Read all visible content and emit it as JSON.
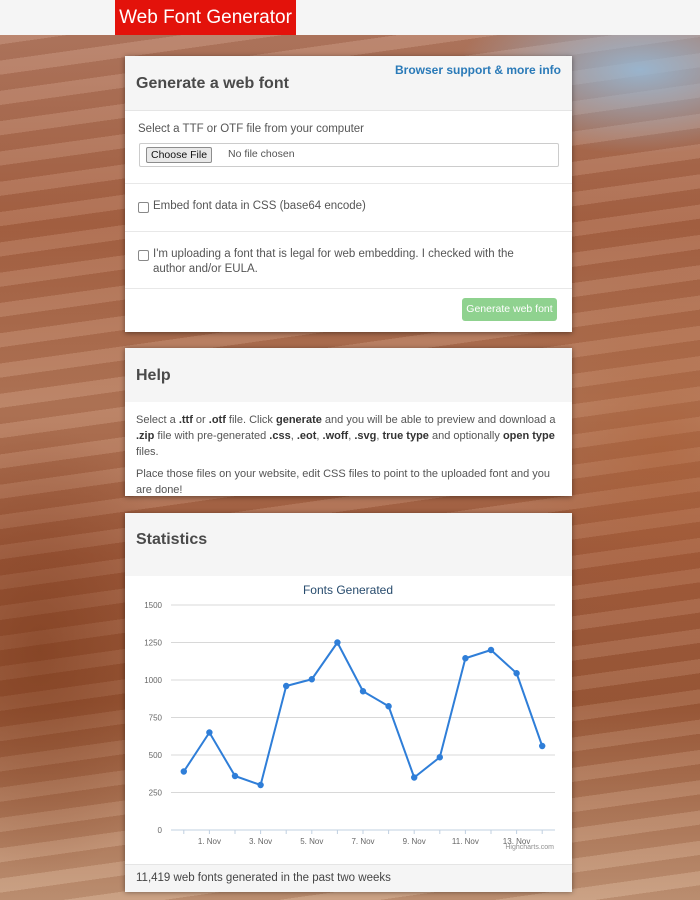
{
  "header": {
    "brand": "Web Font Generator"
  },
  "generate_panel": {
    "title": "Generate a web font",
    "support_link": "Browser support & more info",
    "file_label": "Select a TTF or OTF file from your computer",
    "choose_file_label": "Choose File",
    "file_status": "No file chosen",
    "embed_label": "Embed font data in CSS (base64 encode)",
    "legal_label": "I'm uploading a font that is legal for web embedding. I checked with the author and/or EULA.",
    "generate_button": "Generate web font"
  },
  "help_panel": {
    "title": "Help",
    "p1": [
      {
        "t": "Select a ",
        "b": false
      },
      {
        "t": ".ttf",
        "b": true
      },
      {
        "t": " or ",
        "b": false
      },
      {
        "t": ".otf",
        "b": true
      },
      {
        "t": " file. Click ",
        "b": false
      },
      {
        "t": "generate",
        "b": true
      },
      {
        "t": " and you will be able to preview and download a ",
        "b": false
      },
      {
        "t": ".zip",
        "b": true
      },
      {
        "t": " file with pre-generated ",
        "b": false
      },
      {
        "t": ".css",
        "b": true
      },
      {
        "t": ", ",
        "b": false
      },
      {
        "t": ".eot",
        "b": true
      },
      {
        "t": ", ",
        "b": false
      },
      {
        "t": ".woff",
        "b": true
      },
      {
        "t": ", ",
        "b": false
      },
      {
        "t": ".svg",
        "b": true
      },
      {
        "t": ", ",
        "b": false
      },
      {
        "t": "true type",
        "b": true
      },
      {
        "t": " and optionally ",
        "b": false
      },
      {
        "t": "open type",
        "b": true
      },
      {
        "t": " files.",
        "b": false
      }
    ],
    "p2": "Place those files on your website, edit CSS files to point to the uploaded font and you are done!"
  },
  "stats_panel": {
    "title": "Statistics",
    "footer": "11,419 web fonts generated in the past two weeks"
  },
  "chart_data": {
    "type": "line",
    "title": "Fonts Generated",
    "credit": "Highcharts.com",
    "color": "#2f7ed8",
    "x_tick_labels": [
      "1. Nov",
      "3. Nov",
      "5. Nov",
      "7. Nov",
      "9. Nov",
      "11. Nov",
      "13. Nov"
    ],
    "y_ticks": [
      0,
      250,
      500,
      750,
      1000,
      1250,
      1500
    ],
    "ylim": [
      0,
      1500
    ],
    "x": [
      "31. Oct",
      "1. Nov",
      "2. Nov",
      "3. Nov",
      "4. Nov",
      "5. Nov",
      "6. Nov",
      "7. Nov",
      "8. Nov",
      "9. Nov",
      "10. Nov",
      "11. Nov",
      "12. Nov",
      "13. Nov",
      "14. Nov"
    ],
    "values": [
      390,
      650,
      360,
      300,
      960,
      1005,
      1250,
      925,
      825,
      350,
      485,
      1145,
      1200,
      1045,
      560
    ]
  }
}
